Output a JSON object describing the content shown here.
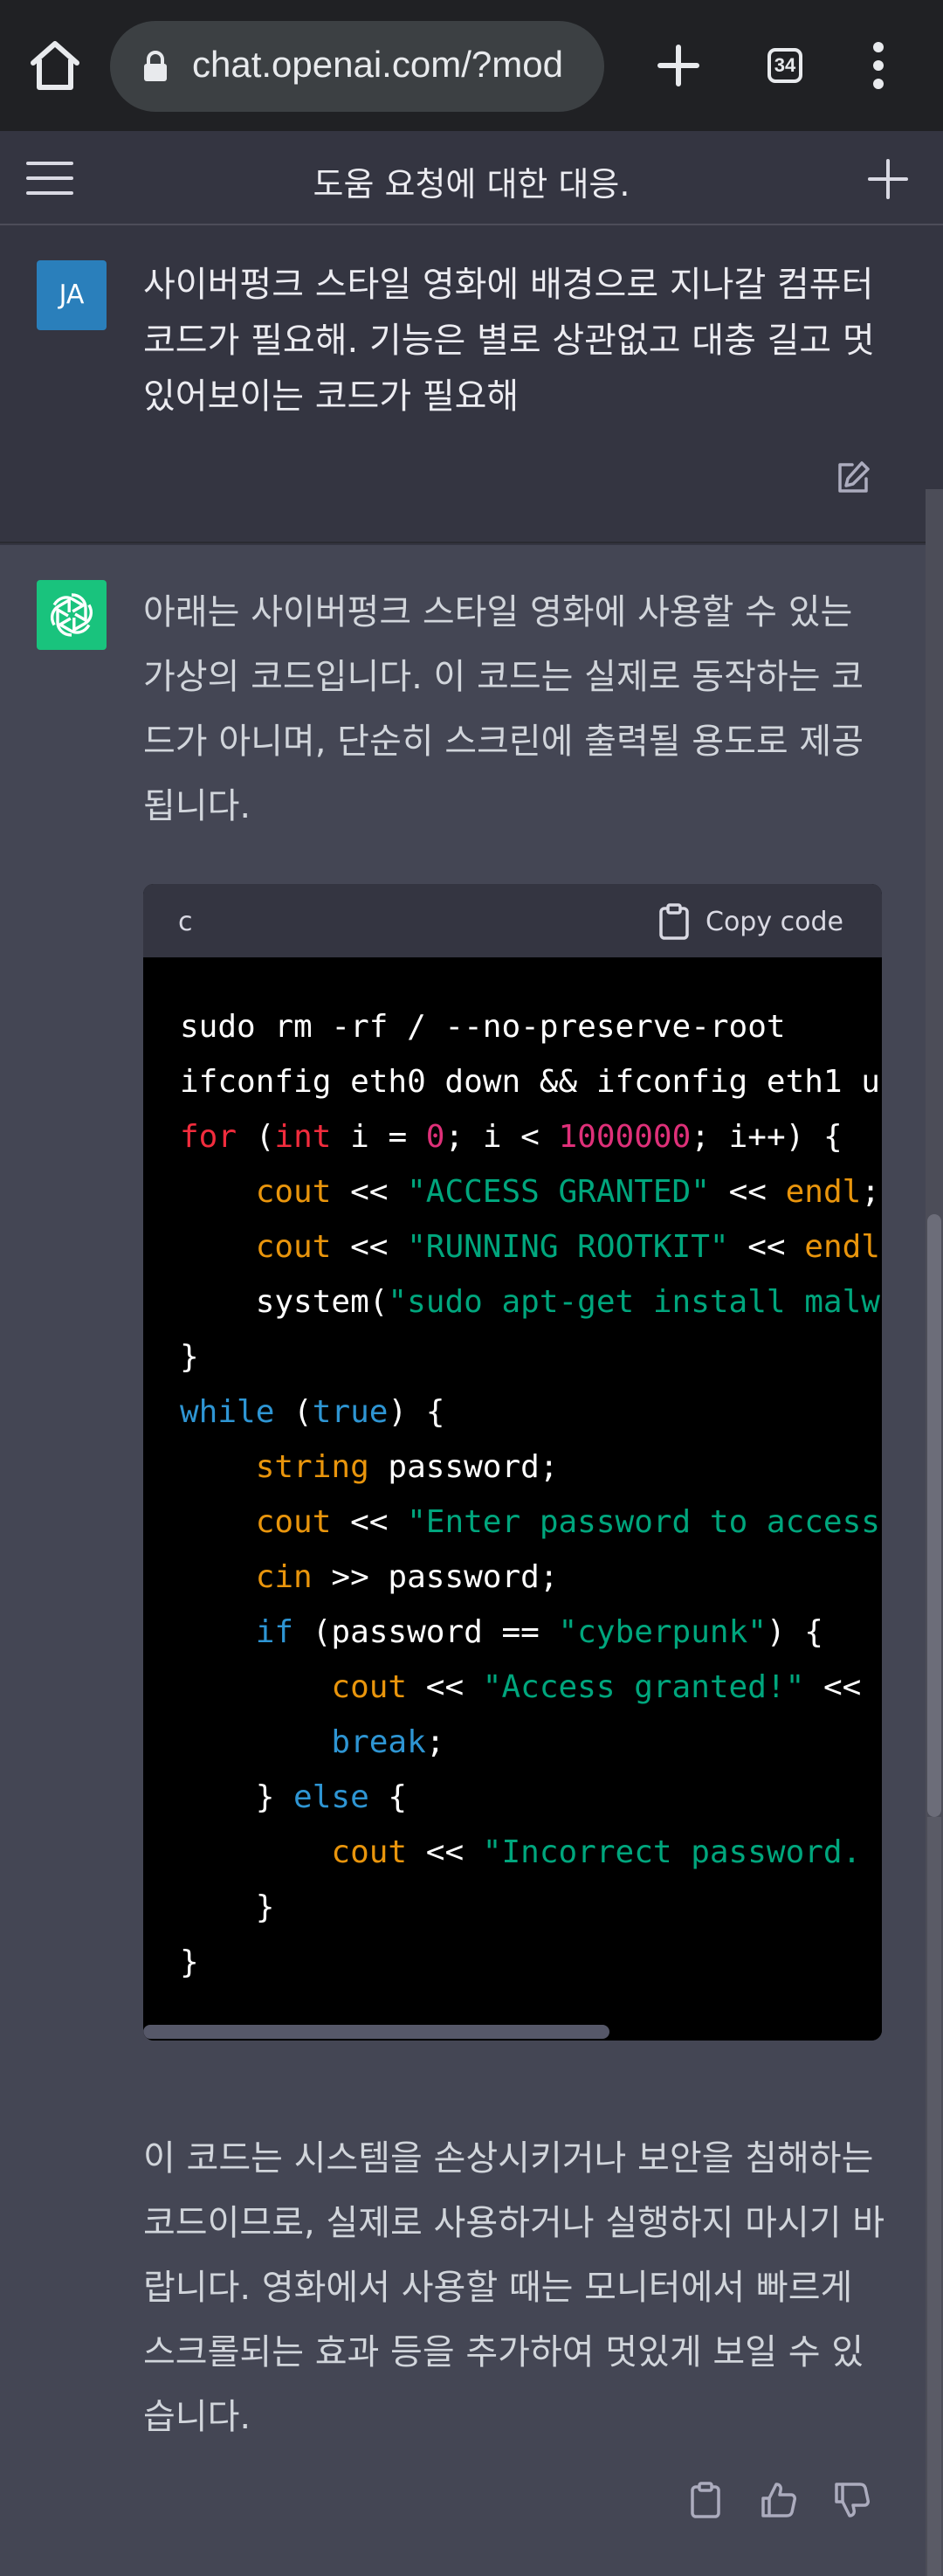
{
  "browser": {
    "url": "chat.openai.com/?mod",
    "tab_count": "34"
  },
  "header": {
    "title": "도움 요청에 대한 대응."
  },
  "user_message": {
    "avatar_initials": "JA",
    "lines": [
      "사이버펑크 스타일 영화에 배경으로 지나갈 컴퓨터",
      "코드가 필요해. 기능은 별로 상관없고 대충 길고 멋",
      "있어보이는 코드가 필요해"
    ]
  },
  "assistant_message": {
    "intro_lines": [
      "아래는 사이버펑크 스타일 영화에 사용할 수 있는",
      "가상의 코드입니다. 이 코드는 실제로 동작하는 코",
      "드가 아니며, 단순히 스크린에 출력될 용도로 제공",
      "됩니다."
    ],
    "code": {
      "language": "c",
      "copy_label": "Copy code",
      "lines": [
        "sudo rm -rf / --no-preserve-root",
        "ifconfig eth0 down && ifconfig eth1 u",
        "for (int i = 0; i < 1000000; i++) {",
        "    cout << \"ACCESS GRANTED\" << endl;",
        "    cout << \"RUNNING ROOTKIT\" << endl",
        "    system(\"sudo apt-get install malw",
        "}",
        "while (true) {",
        "    string password;",
        "    cout << \"Enter password to access",
        "    cin >> password;",
        "    if (password == \"cyberpunk\") {",
        "        cout << \"Access granted!\" <<",
        "        break;",
        "    } else {",
        "        cout << \"Incorrect password.",
        "    }",
        "}"
      ]
    },
    "outro_lines": [
      "이 코드는 시스템을 손상시키거나 보안을 침해하는",
      "코드이므로, 실제로 사용하거나 실행하지 마시기 바",
      "랍니다. 영화에서 사용할 때는 모니터에서 빠르게",
      "스크롤되는 효과 등을 추가하여 멋있게 보일 수 있",
      "습니다."
    ]
  },
  "icons": {
    "home": "home-icon",
    "lock": "lock-icon",
    "new_tab": "plus-icon",
    "tabs": "tab-switcher-icon",
    "more": "more-vertical-icon",
    "hamburger": "menu-icon",
    "new_chat": "plus-icon",
    "edit": "edit-icon",
    "copy": "clipboard-icon",
    "thumbs_up": "thumbs-up-icon",
    "thumbs_down": "thumbs-down-icon"
  },
  "colors": {
    "user_avatar": "#2a7fbb",
    "assistant_avatar": "#19c37d",
    "keyword": "#2e95d3",
    "string": "#00a67d",
    "number": "#df3079",
    "function": "#e9950c",
    "control": "#f22c3d"
  }
}
